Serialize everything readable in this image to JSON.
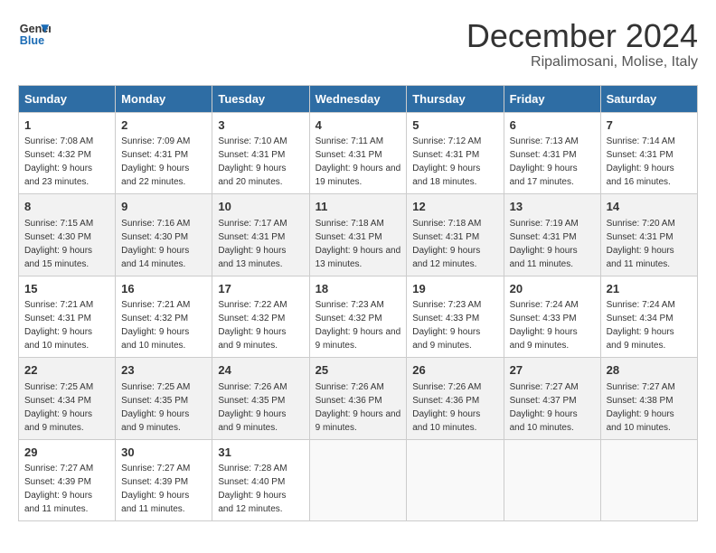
{
  "logo": {
    "line1": "General",
    "line2": "Blue"
  },
  "title": "December 2024",
  "subtitle": "Ripalimosani, Molise, Italy",
  "weekdays": [
    "Sunday",
    "Monday",
    "Tuesday",
    "Wednesday",
    "Thursday",
    "Friday",
    "Saturday"
  ],
  "weeks": [
    [
      {
        "day": "1",
        "sunrise": "7:08 AM",
        "sunset": "4:32 PM",
        "daylight": "9 hours and 23 minutes."
      },
      {
        "day": "2",
        "sunrise": "7:09 AM",
        "sunset": "4:31 PM",
        "daylight": "9 hours and 22 minutes."
      },
      {
        "day": "3",
        "sunrise": "7:10 AM",
        "sunset": "4:31 PM",
        "daylight": "9 hours and 20 minutes."
      },
      {
        "day": "4",
        "sunrise": "7:11 AM",
        "sunset": "4:31 PM",
        "daylight": "9 hours and 19 minutes."
      },
      {
        "day": "5",
        "sunrise": "7:12 AM",
        "sunset": "4:31 PM",
        "daylight": "9 hours and 18 minutes."
      },
      {
        "day": "6",
        "sunrise": "7:13 AM",
        "sunset": "4:31 PM",
        "daylight": "9 hours and 17 minutes."
      },
      {
        "day": "7",
        "sunrise": "7:14 AM",
        "sunset": "4:31 PM",
        "daylight": "9 hours and 16 minutes."
      }
    ],
    [
      {
        "day": "8",
        "sunrise": "7:15 AM",
        "sunset": "4:30 PM",
        "daylight": "9 hours and 15 minutes."
      },
      {
        "day": "9",
        "sunrise": "7:16 AM",
        "sunset": "4:30 PM",
        "daylight": "9 hours and 14 minutes."
      },
      {
        "day": "10",
        "sunrise": "7:17 AM",
        "sunset": "4:31 PM",
        "daylight": "9 hours and 13 minutes."
      },
      {
        "day": "11",
        "sunrise": "7:18 AM",
        "sunset": "4:31 PM",
        "daylight": "9 hours and 13 minutes."
      },
      {
        "day": "12",
        "sunrise": "7:18 AM",
        "sunset": "4:31 PM",
        "daylight": "9 hours and 12 minutes."
      },
      {
        "day": "13",
        "sunrise": "7:19 AM",
        "sunset": "4:31 PM",
        "daylight": "9 hours and 11 minutes."
      },
      {
        "day": "14",
        "sunrise": "7:20 AM",
        "sunset": "4:31 PM",
        "daylight": "9 hours and 11 minutes."
      }
    ],
    [
      {
        "day": "15",
        "sunrise": "7:21 AM",
        "sunset": "4:31 PM",
        "daylight": "9 hours and 10 minutes."
      },
      {
        "day": "16",
        "sunrise": "7:21 AM",
        "sunset": "4:32 PM",
        "daylight": "9 hours and 10 minutes."
      },
      {
        "day": "17",
        "sunrise": "7:22 AM",
        "sunset": "4:32 PM",
        "daylight": "9 hours and 9 minutes."
      },
      {
        "day": "18",
        "sunrise": "7:23 AM",
        "sunset": "4:32 PM",
        "daylight": "9 hours and 9 minutes."
      },
      {
        "day": "19",
        "sunrise": "7:23 AM",
        "sunset": "4:33 PM",
        "daylight": "9 hours and 9 minutes."
      },
      {
        "day": "20",
        "sunrise": "7:24 AM",
        "sunset": "4:33 PM",
        "daylight": "9 hours and 9 minutes."
      },
      {
        "day": "21",
        "sunrise": "7:24 AM",
        "sunset": "4:34 PM",
        "daylight": "9 hours and 9 minutes."
      }
    ],
    [
      {
        "day": "22",
        "sunrise": "7:25 AM",
        "sunset": "4:34 PM",
        "daylight": "9 hours and 9 minutes."
      },
      {
        "day": "23",
        "sunrise": "7:25 AM",
        "sunset": "4:35 PM",
        "daylight": "9 hours and 9 minutes."
      },
      {
        "day": "24",
        "sunrise": "7:26 AM",
        "sunset": "4:35 PM",
        "daylight": "9 hours and 9 minutes."
      },
      {
        "day": "25",
        "sunrise": "7:26 AM",
        "sunset": "4:36 PM",
        "daylight": "9 hours and 9 minutes."
      },
      {
        "day": "26",
        "sunrise": "7:26 AM",
        "sunset": "4:36 PM",
        "daylight": "9 hours and 10 minutes."
      },
      {
        "day": "27",
        "sunrise": "7:27 AM",
        "sunset": "4:37 PM",
        "daylight": "9 hours and 10 minutes."
      },
      {
        "day": "28",
        "sunrise": "7:27 AM",
        "sunset": "4:38 PM",
        "daylight": "9 hours and 10 minutes."
      }
    ],
    [
      {
        "day": "29",
        "sunrise": "7:27 AM",
        "sunset": "4:39 PM",
        "daylight": "9 hours and 11 minutes."
      },
      {
        "day": "30",
        "sunrise": "7:27 AM",
        "sunset": "4:39 PM",
        "daylight": "9 hours and 11 minutes."
      },
      {
        "day": "31",
        "sunrise": "7:28 AM",
        "sunset": "4:40 PM",
        "daylight": "9 hours and 12 minutes."
      },
      null,
      null,
      null,
      null
    ]
  ],
  "labels": {
    "sunrise": "Sunrise:",
    "sunset": "Sunset:",
    "daylight": "Daylight:"
  }
}
